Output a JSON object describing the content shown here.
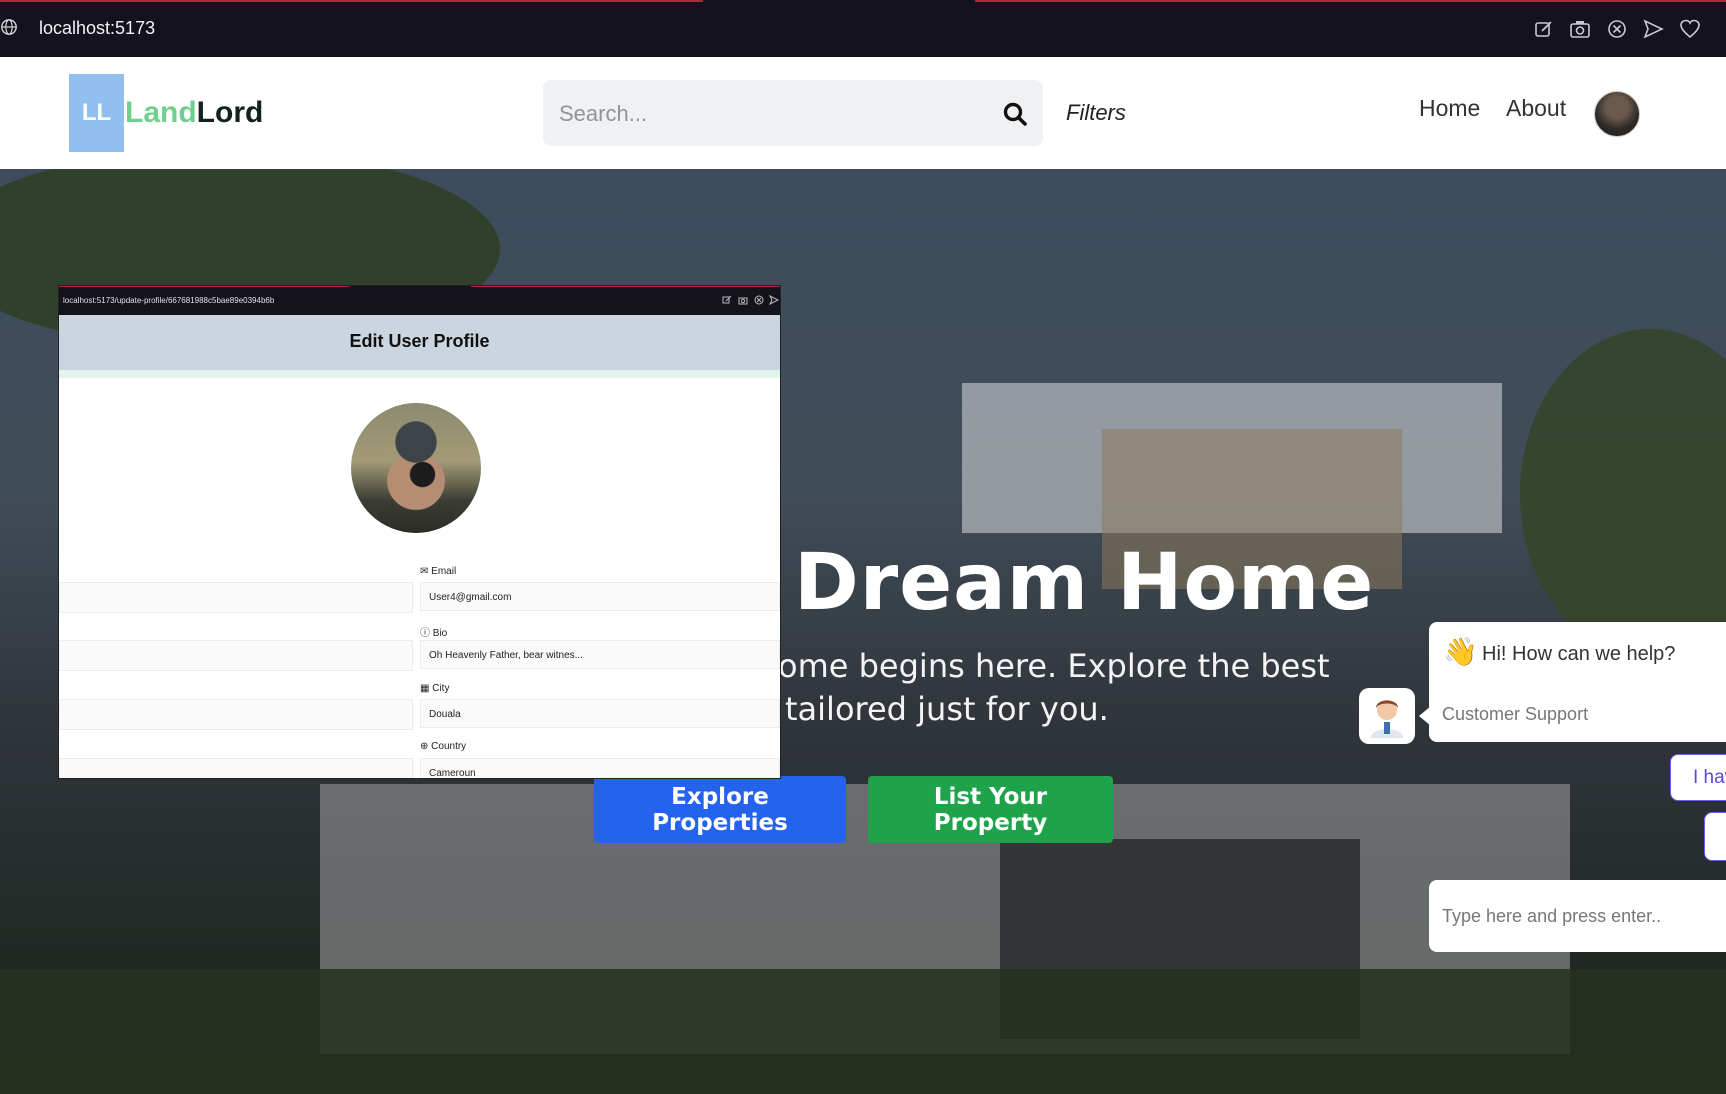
{
  "browser": {
    "url": "localhost:5173",
    "icons": [
      "globe-icon",
      "edit-icon",
      "camera-icon",
      "close-circle-icon",
      "send-icon",
      "heart-icon"
    ]
  },
  "navbar": {
    "logo_initials": "LL",
    "logo_land": "Land",
    "logo_lord": "Lord",
    "search_placeholder": "Search...",
    "filters_label": "Filters",
    "links": [
      "Home",
      "About"
    ]
  },
  "hero": {
    "title": "Dream Home",
    "subtitle_line1": "ome begins here. Explore the best",
    "subtitle_line2": "tailored just for you.",
    "explore_label": "Explore Properties",
    "list_label": "List Your Property"
  },
  "overlay_screenshot": {
    "url": "localhost:5173/update-profile/667681988c5bae89e0394b6b",
    "title": "Edit User Profile",
    "fields": [
      {
        "label": "Email",
        "value": "User4@gmail.com",
        "icon": "envelope-icon"
      },
      {
        "label": "Bio",
        "value": "Oh Heavenly Father, bear witnes...",
        "icon": "info-icon"
      },
      {
        "label": "City",
        "value": "Douala",
        "icon": "city-icon"
      },
      {
        "label": "Country",
        "value": "Cameroun",
        "icon": "globe-icon"
      }
    ]
  },
  "chat": {
    "greeting": "Hi! How can we help?",
    "agent_name": "Customer Support",
    "reply_chip": "I hav",
    "input_placeholder": "Type here and press enter.."
  },
  "colors": {
    "explore_button": "#2463eb",
    "list_button": "#1fa34a",
    "logo_box": "#90bff0",
    "logo_land": "#6ed08c"
  }
}
